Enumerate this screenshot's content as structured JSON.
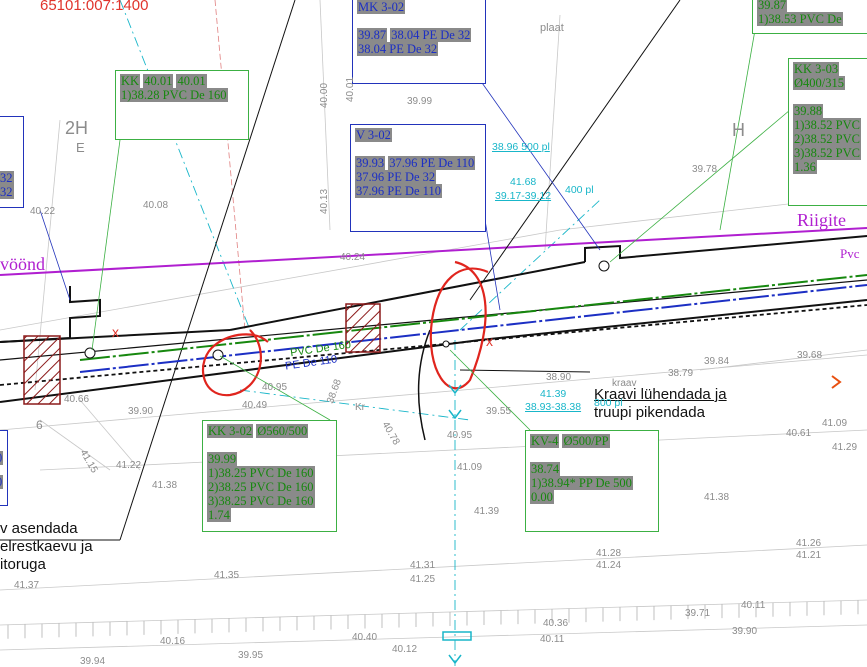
{
  "header_ref": "65101:007:1400",
  "road_labels": {
    "left": "vöönd",
    "right": "Riigite",
    "right_small": "Pvc"
  },
  "notes": {
    "left_lines": [
      "v asendada",
      "elrestkaevu ja",
      "itoruga"
    ],
    "right_lines": [
      "Kraavi lühendada ja",
      "truupi pikendada"
    ]
  },
  "callouts": {
    "mk_302": {
      "title": "MK 3-02",
      "lines": [
        "39.87",
        "38.04 PE De 32",
        "38.04 PE De 32"
      ]
    },
    "kk_left": {
      "title": "KK",
      "lines": [
        "40.01",
        "40.01",
        "1)38.28 PVC De 160"
      ]
    },
    "v_302": {
      "title": "V 3-02",
      "lines": [
        "39.93",
        "37.96 PE De 110",
        "37.96 PE De 32",
        "37.96 PE De 110"
      ]
    },
    "kk_303": {
      "title": "KK 3-03",
      "subtitle": "Ø400/315",
      "lines": [
        "39.88",
        "1)38.52 PVC",
        "2)38.52 PVC",
        "3)38.52 PVC",
        "1.36"
      ]
    },
    "top_right": {
      "lines": [
        "39.87",
        "1)38.53 PVC De"
      ]
    },
    "left_edge": {
      "lines": [
        "32",
        "32"
      ]
    },
    "kk_302": {
      "title": "KK 3-02",
      "subtitle": "Ø560/500",
      "lines": [
        "39.99",
        "1)38.25 PVC De 160",
        "2)38.25 PVC De 160",
        "3)38.25 PVC De 160",
        "1.74"
      ]
    },
    "kv_4": {
      "title": "KV-4",
      "subtitle": "Ø500/PP",
      "lines": [
        "38.74",
        "1)38.94* PP De 500",
        "0.00"
      ]
    },
    "left_bottom": {
      "lines": [
        "0",
        "0"
      ]
    }
  },
  "cyan_labels": [
    "38.96 500 pl",
    "41.68",
    "39.17-39.12",
    "400 pl",
    "41.39",
    "38.93-38.38",
    "800 pl"
  ],
  "pipe_labels": {
    "pe110": "PE De 110",
    "pvc160": "PVC De 160"
  },
  "red_marks": [
    "x",
    "x"
  ],
  "elevations": [
    "39.99",
    "40.00",
    "40.01",
    "40.13",
    "40.08",
    "40.22",
    "40.24",
    "39.78",
    "39.84",
    "39.68",
    "38.79",
    "38.90",
    "39.55",
    "38.68",
    "40.78",
    "40.95",
    "41.09",
    "41.38",
    "41.39",
    "41.31",
    "41.25",
    "41.28",
    "41.24",
    "41.26",
    "41.21",
    "41.35",
    "41.37",
    "40.16",
    "40.40",
    "40.36",
    "40.11",
    "39.71",
    "39.90",
    "39.95",
    "39.94",
    "40.66",
    "39.90",
    "40.49",
    "41.22",
    "41.38",
    "41.15",
    "40.95",
    "41.09",
    "41.29",
    "40.61",
    "40.12",
    "40.11"
  ],
  "misc": {
    "plaat": "plaat",
    "kraav": "kraav",
    "kr": "Kr",
    "h_right": "H",
    "h_left": "2H",
    "e_left": "E",
    "d_left": "6"
  }
}
